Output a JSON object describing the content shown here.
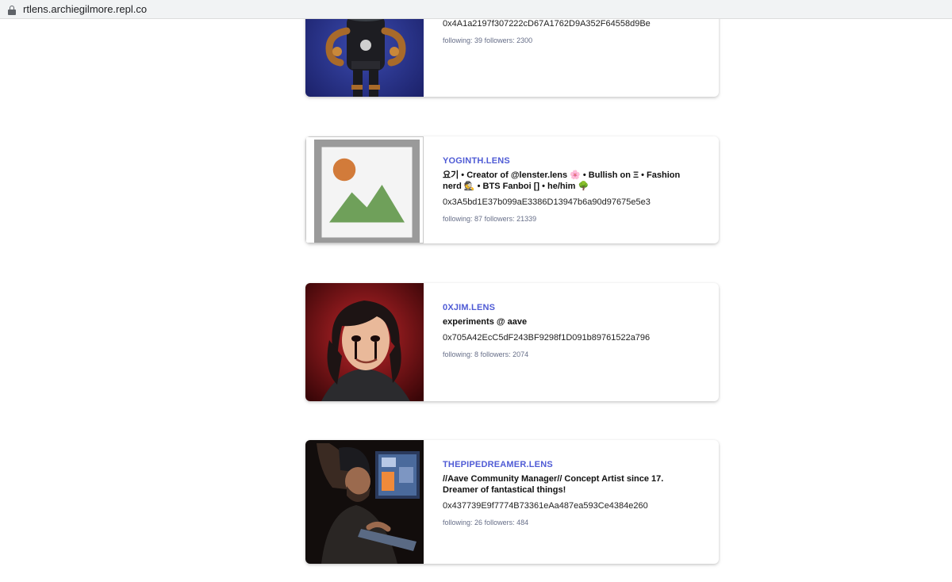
{
  "browser": {
    "url": "rtlens.archiegilmore.repl.co"
  },
  "profiles": [
    {
      "handle": "",
      "bio": "",
      "address": "0x4A1a2197f307222cD67A1762D9A352F64558d9Be",
      "following_label": "following:",
      "following": "39",
      "followers_label": "followers:",
      "followers": "2300"
    },
    {
      "handle": "YOGINTH.LENS",
      "bio": "요기 • Creator of @lenster.lens 🌸 • Bullish on Ξ • Fashion nerd 🕵 • BTS Fanboi [] • he/him 🌳",
      "address": "0x3A5bd1E37b099aE3386D13947b6a90d97675e5e3",
      "following_label": "following:",
      "following": "87",
      "followers_label": "followers:",
      "followers": "21339"
    },
    {
      "handle": "0XJIM.LENS",
      "bio": "experiments @ aave",
      "address": "0x705A42EcC5dF243BF9298f1D091b89761522a796",
      "following_label": "following:",
      "following": "8",
      "followers_label": "followers:",
      "followers": "2074"
    },
    {
      "handle": "THEPIPEDREAMER.LENS",
      "bio": "//Aave Community Manager// Concept Artist since 17. Dreamer of fantastical things!",
      "address": "0x437739E9f7774B73361eAa487ea593Ce4384e260",
      "following_label": "following:",
      "following": "26",
      "followers_label": "followers:",
      "followers": "484"
    }
  ]
}
